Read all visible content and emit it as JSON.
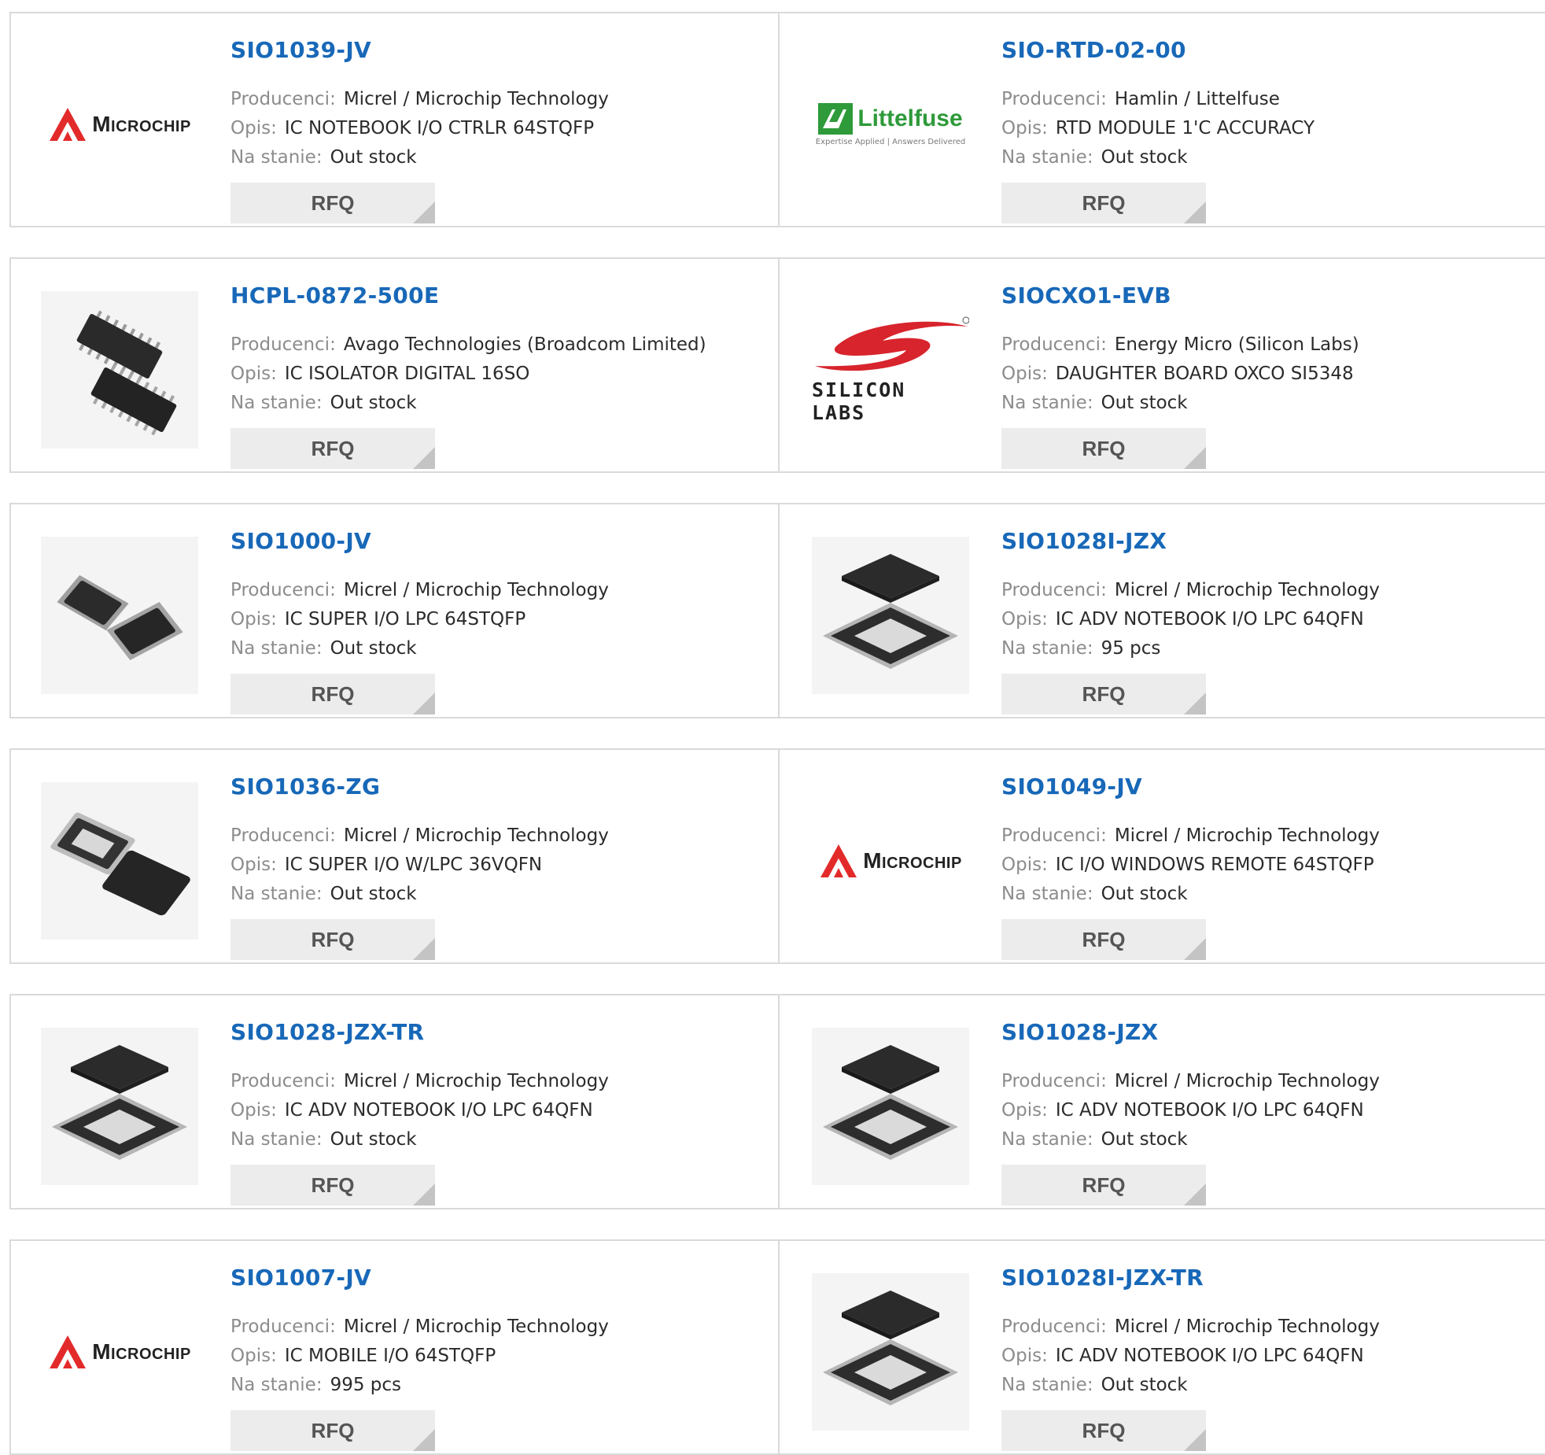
{
  "labels": {
    "manufacturer": "Producenci:",
    "description": "Opis:",
    "stock": "Na stanie:",
    "rfq": "RFQ"
  },
  "colors": {
    "link": "#1868b8",
    "border": "#dadada",
    "button_bg": "#ececec"
  },
  "brands": {
    "microchip": "Microchip",
    "littelfuse": "Littelfuse",
    "littelfuse_tagline": "Expertise Applied | Answers Delivered",
    "silicon_labs": "SILICON LABS"
  },
  "products": [
    {
      "part": "SIO1039-JV",
      "manufacturer": "Micrel / Microchip Technology",
      "description": "IC NOTEBOOK I/O CTRLR 64STQFP",
      "stock": "Out stock",
      "image": "microchip-logo"
    },
    {
      "part": "SIO-RTD-02-00",
      "manufacturer": "Hamlin / Littelfuse",
      "description": "RTD MODULE 1'C ACCURACY",
      "stock": "Out stock",
      "image": "littelfuse-logo"
    },
    {
      "part": "HCPL-0872-500E",
      "manufacturer": "Avago Technologies (Broadcom Limited)",
      "description": "IC ISOLATOR DIGITAL 16SO",
      "stock": "Out stock",
      "image": "soic-chip-photo"
    },
    {
      "part": "SIOCXO1-EVB",
      "manufacturer": "Energy Micro (Silicon Labs)",
      "description": "DAUGHTER BOARD OXCO SI5348",
      "stock": "Out stock",
      "image": "silicon-labs-logo"
    },
    {
      "part": "SIO1000-JV",
      "manufacturer": "Micrel / Microchip Technology",
      "description": "IC SUPER I/O LPC 64STQFP",
      "stock": "Out stock",
      "image": "qfp-chip-photo"
    },
    {
      "part": "SIO1028I-JZX",
      "manufacturer": "Micrel / Microchip Technology",
      "description": "IC ADV NOTEBOOK I/O LPC 64QFN",
      "stock": "95 pcs",
      "image": "qfn-chip-photo"
    },
    {
      "part": "SIO1036-ZG",
      "manufacturer": "Micrel / Microchip Technology",
      "description": "IC SUPER I/O W/LPC 36VQFN",
      "stock": "Out stock",
      "image": "vqfn-chip-photo"
    },
    {
      "part": "SIO1049-JV",
      "manufacturer": "Micrel / Microchip Technology",
      "description": "IC I/O WINDOWS REMOTE 64STQFP",
      "stock": "Out stock",
      "image": "microchip-logo"
    },
    {
      "part": "SIO1028-JZX-TR",
      "manufacturer": "Micrel / Microchip Technology",
      "description": "IC ADV NOTEBOOK I/O LPC 64QFN",
      "stock": "Out stock",
      "image": "qfn-chip-photo"
    },
    {
      "part": "SIO1028-JZX",
      "manufacturer": "Micrel / Microchip Technology",
      "description": "IC ADV NOTEBOOK I/O LPC 64QFN",
      "stock": "Out stock",
      "image": "qfn-chip-photo"
    },
    {
      "part": "SIO1007-JV",
      "manufacturer": "Micrel / Microchip Technology",
      "description": "IC MOBILE I/O 64STQFP",
      "stock": "995 pcs",
      "image": "microchip-logo"
    },
    {
      "part": "SIO1028I-JZX-TR",
      "manufacturer": "Micrel / Microchip Technology",
      "description": "IC ADV NOTEBOOK I/O LPC 64QFN",
      "stock": "Out stock",
      "image": "qfn-chip-photo"
    }
  ]
}
